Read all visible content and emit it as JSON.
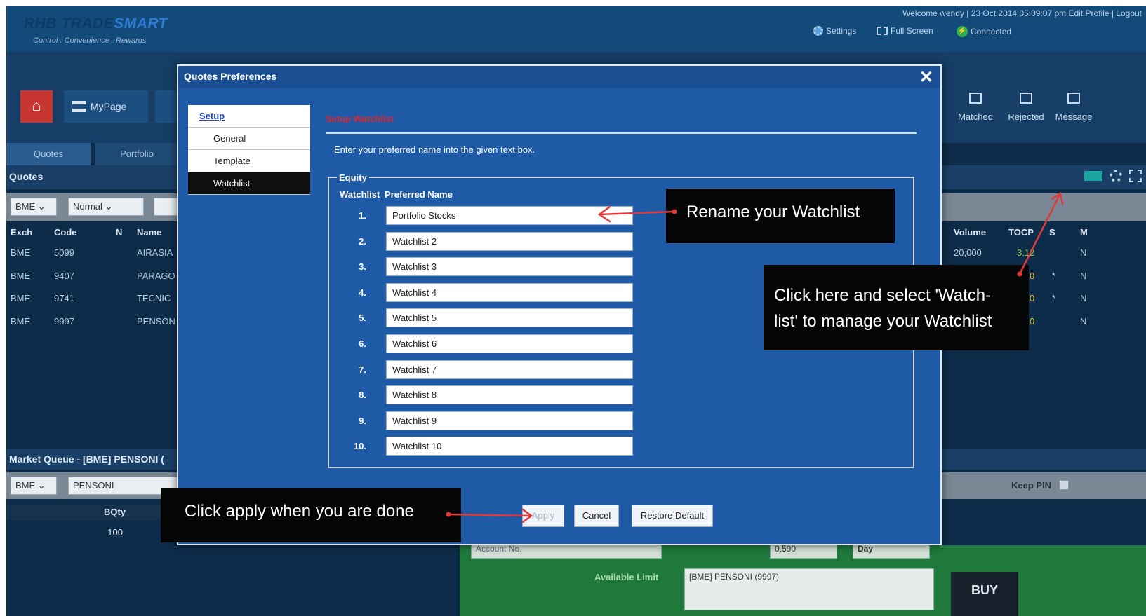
{
  "header": {
    "logo": "RHB TRADESMART",
    "logo_prefix": "RHB ",
    "logo_part1": "TRADE",
    "logo_part2": "SMART",
    "tagline": "Control . Convenience . Rewards",
    "welcome": "Welcome wendy | 23 Oct 2014 05:09:07 pm    Edit Profile | Logout",
    "settings": "Settings",
    "full_screen": "Full Screen",
    "connected": "Connected"
  },
  "nav": {
    "mypage": "MyPage",
    "tabs": [
      "Quotes",
      "Portfolio"
    ],
    "right_icons": [
      "Matched",
      "Rejected",
      "Message"
    ]
  },
  "quotes": {
    "title": "Quotes",
    "filters": [
      "BME",
      "Normal"
    ],
    "headers": [
      "Exch",
      "Code",
      "N",
      "Name"
    ],
    "right_headers": [
      "Volume",
      "TOCP",
      "S",
      "M"
    ],
    "rows": [
      {
        "exch": "BME",
        "code": "5099",
        "name": "AIRASIA",
        "volume": "20,000",
        "tocp": "3.12",
        "s": "",
        "m": "N"
      },
      {
        "exch": "BME",
        "code": "9407",
        "name": "PARAGO",
        "volume": "",
        "tocp": "0",
        "s": "*",
        "m": "N"
      },
      {
        "exch": "BME",
        "code": "9741",
        "name": "TECNIC",
        "volume": "",
        "tocp": "0",
        "s": "*",
        "m": "N"
      },
      {
        "exch": "BME",
        "code": "9997",
        "name": "PENSON",
        "volume": "",
        "tocp": "0",
        "s": "",
        "m": "N"
      }
    ]
  },
  "market_queue": {
    "title": "Market Queue - [BME] PENSONI (",
    "exch": "BME",
    "stock": "PENSONI",
    "bqty_header": "BQty",
    "bqty_value": "100",
    "keep_pin": "Keep PIN"
  },
  "order": {
    "account_placeholder": "Account No.",
    "available_limit": "Available Limit",
    "price": "0.590",
    "validity": "Day",
    "stock": "[BME] PENSONI (9997)",
    "buy": "BUY"
  },
  "modal": {
    "title": "Quotes Preferences",
    "close": "✕",
    "menu": [
      "Setup",
      "General",
      "Template",
      "Watchlist"
    ],
    "section_title": "Setup Watchlist",
    "instruction": "Enter your preferred name into the given text box.",
    "group_label": "Equity",
    "col_watchlist": "Watchlist",
    "col_preferred": "Preferred Name",
    "watchlists": [
      {
        "num": "1.",
        "name": "Portfolio Stocks"
      },
      {
        "num": "2.",
        "name": "Watchlist 2"
      },
      {
        "num": "3.",
        "name": "Watchlist 3"
      },
      {
        "num": "4.",
        "name": "Watchlist 4"
      },
      {
        "num": "5.",
        "name": "Watchlist 5"
      },
      {
        "num": "6.",
        "name": "Watchlist 6"
      },
      {
        "num": "7.",
        "name": "Watchlist 7"
      },
      {
        "num": "8.",
        "name": "Watchlist 8"
      },
      {
        "num": "9.",
        "name": "Watchlist 9"
      },
      {
        "num": "10.",
        "name": "Watchlist 10"
      }
    ],
    "apply": "Apply",
    "cancel": "Cancel",
    "restore": "Restore Default"
  },
  "annotations": {
    "rename": "Rename your Watchlist",
    "watchlist_line1": "Click here and select 'Watch-",
    "watchlist_line2": "list' to manage your Watchlist",
    "apply": "Click apply when you are done"
  },
  "colors": {
    "modal_bg": "#1f5aa6",
    "accent_red": "#e0272b",
    "callout_bg": "#050505",
    "arrow": "#e0393b"
  },
  "icons": [
    "home-icon",
    "gear-icon",
    "fullscreen-icon",
    "connected-icon",
    "close-icon",
    "matched-icon",
    "rejected-icon",
    "message-icon"
  ]
}
